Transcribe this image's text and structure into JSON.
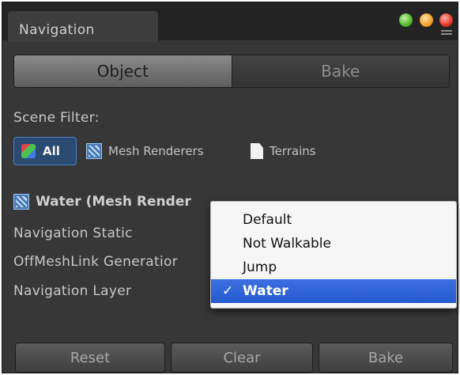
{
  "window": {
    "tab_title": "Navigation"
  },
  "toolbar": {
    "tabs": [
      {
        "label": "Object",
        "active": true
      },
      {
        "label": "Bake",
        "active": false
      }
    ]
  },
  "scene_filter": {
    "label": "Scene Filter:",
    "buttons": [
      {
        "label": "All",
        "icon": "cube-icon",
        "selected": true
      },
      {
        "label": "Mesh Renderers",
        "icon": "mesh-renderer-icon",
        "selected": false
      },
      {
        "label": "Terrains",
        "icon": "terrain-file-icon",
        "selected": false
      }
    ]
  },
  "object": {
    "name": "Water (Mesh Render",
    "icon": "mesh-renderer-icon"
  },
  "properties": [
    {
      "label": "Navigation Static"
    },
    {
      "label": "OffMeshLink Generatior"
    },
    {
      "label": "Navigation Layer"
    }
  ],
  "layer_dropdown": {
    "options": [
      "Default",
      "Not Walkable",
      "Jump",
      "Water"
    ],
    "selected": "Water",
    "check": "✓"
  },
  "bottom_buttons": {
    "reset": "Reset",
    "clear": "Clear",
    "bake": "Bake"
  },
  "colors": {
    "panel": "#373737",
    "selection_blue": "#2b5fd6",
    "all_button": "#2b4a72"
  }
}
